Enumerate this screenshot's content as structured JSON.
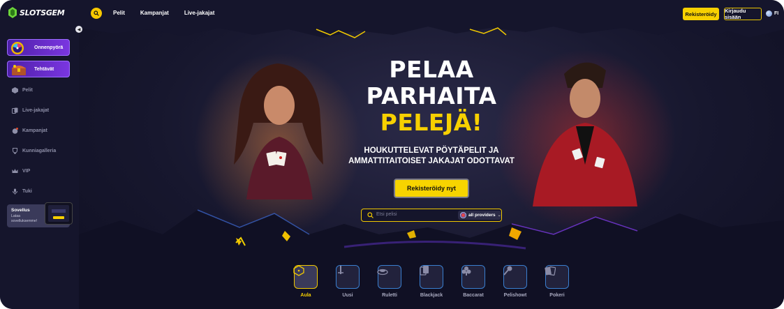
{
  "header": {
    "logo_text": "SLOTSGEM",
    "nav": [
      "Pelit",
      "Kampanjat",
      "Live-jakajat"
    ],
    "register_label": "Rekisteröidy",
    "login_label": "Kirjaudu sisään",
    "language": "FI"
  },
  "sidebar": {
    "promos": [
      "Onnenpyörä",
      "Tehtävät"
    ],
    "items": [
      "Pelit",
      "Live-jakajat",
      "Kampanjat",
      "Kunniagalleria",
      "VIP",
      "Tuki"
    ],
    "app_card": {
      "title": "Sovellus",
      "text": "Lataa sovelluksemme!"
    }
  },
  "hero": {
    "title_lines": [
      "PELAA",
      "PARHAITA",
      "PELEJÄ!"
    ],
    "subtitle_lines": [
      "HOUKUTTELEVAT PÖYTÄPELIT JA",
      "AMMATTITAITOISET JAKAJAT ODOTTAVAT"
    ],
    "cta_label": "Rekisteröidy nyt",
    "search_placeholder": "Etsi pelisi",
    "providers_label": "all providers"
  },
  "categories": [
    {
      "label": "Aula",
      "active": true
    },
    {
      "label": "Uusi",
      "active": false
    },
    {
      "label": "Ruletti",
      "active": false
    },
    {
      "label": "Blackjack",
      "active": false
    },
    {
      "label": "Baccarat",
      "active": false
    },
    {
      "label": "Pelishowt",
      "active": false
    },
    {
      "label": "Pokeri",
      "active": false
    }
  ],
  "colors": {
    "accent": "#f7d000",
    "background": "#14142b",
    "promo": "#6a2fd0"
  }
}
